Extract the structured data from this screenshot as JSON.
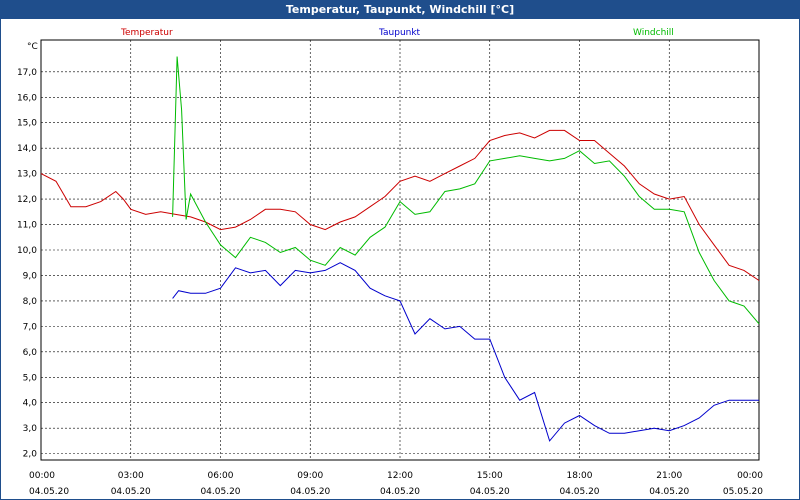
{
  "window": {
    "title": "Temperatur, Taupunkt, Windchill [°C]"
  },
  "chart_data": {
    "type": "line",
    "title": "Temperatur, Taupunkt, Windchill [°C]",
    "ylabel": "°C",
    "ylim": [
      1.75,
      18.25
    ],
    "xlim_hours": [
      0,
      24
    ],
    "grid": true,
    "legend": "top",
    "y_ticks": [
      "2,0",
      "3,0",
      "4,0",
      "5,0",
      "6,0",
      "7,0",
      "8,0",
      "9,0",
      "10,0",
      "11,0",
      "12,0",
      "13,0",
      "14,0",
      "15,0",
      "16,0",
      "17,0"
    ],
    "x_ticks": [
      {
        "time": "00:00",
        "date": "04.05.20"
      },
      {
        "time": "03:00",
        "date": "04.05.20"
      },
      {
        "time": "06:00",
        "date": "04.05.20"
      },
      {
        "time": "09:00",
        "date": "04.05.20"
      },
      {
        "time": "12:00",
        "date": "04.05.20"
      },
      {
        "time": "15:00",
        "date": "04.05.20"
      },
      {
        "time": "18:00",
        "date": "04.05.20"
      },
      {
        "time": "21:00",
        "date": "04.05.20"
      },
      {
        "time": "00:00",
        "date": "05.05.20"
      }
    ],
    "series": [
      {
        "name": "Temperatur",
        "color": "#cc0000",
        "x": [
          0,
          0.5,
          1,
          1.5,
          2,
          2.5,
          2.75,
          3,
          3.5,
          4,
          4.5,
          5,
          5.5,
          6,
          6.5,
          7,
          7.5,
          8,
          8.5,
          9,
          9.5,
          10,
          10.5,
          11,
          11.5,
          12,
          12.5,
          13,
          13.5,
          14,
          14.5,
          15,
          15.5,
          16,
          16.5,
          17,
          17.5,
          18,
          18.5,
          19,
          19.5,
          20,
          20.5,
          21,
          21.5,
          22,
          22.5,
          23,
          23.5,
          24
        ],
        "values": [
          13.0,
          12.7,
          11.7,
          11.7,
          11.9,
          12.3,
          12.0,
          11.6,
          11.4,
          11.5,
          11.4,
          11.3,
          11.1,
          10.8,
          10.9,
          11.2,
          11.6,
          11.6,
          11.5,
          11.0,
          10.8,
          11.1,
          11.3,
          11.7,
          12.1,
          12.7,
          12.9,
          12.7,
          13.0,
          13.3,
          13.6,
          14.3,
          14.5,
          14.6,
          14.4,
          14.7,
          14.7,
          14.3,
          14.3,
          13.8,
          13.3,
          12.6,
          12.2,
          12.0,
          12.1,
          11.0,
          10.2,
          9.4,
          9.2,
          8.8
        ]
      },
      {
        "name": "Taupunkt",
        "color": "#0000cc",
        "x": [
          4.4,
          4.6,
          5,
          5.5,
          6,
          6.5,
          7,
          7.5,
          8,
          8.5,
          9,
          9.5,
          10,
          10.5,
          11,
          11.5,
          12,
          12.5,
          13,
          13.5,
          14,
          14.5,
          15,
          15.5,
          16,
          16.5,
          17,
          17.5,
          18,
          18.5,
          19,
          19.5,
          20,
          20.5,
          21,
          21.5,
          22,
          22.5,
          23,
          23.5,
          24
        ],
        "values": [
          8.1,
          8.4,
          8.3,
          8.3,
          8.5,
          9.3,
          9.1,
          9.2,
          8.6,
          9.2,
          9.1,
          9.2,
          9.5,
          9.2,
          8.5,
          8.2,
          8.0,
          6.7,
          7.3,
          6.9,
          7.0,
          6.5,
          6.5,
          5.0,
          4.1,
          4.4,
          2.5,
          3.2,
          3.5,
          3.1,
          2.8,
          2.8,
          2.9,
          3.0,
          2.9,
          3.1,
          3.4,
          3.9,
          4.1,
          4.1,
          4.1
        ]
      },
      {
        "name": "Windchill",
        "color": "#00bb00",
        "x": [
          4.4,
          4.55,
          4.7,
          4.85,
          5.0,
          5.5,
          6,
          6.5,
          7,
          7.5,
          8,
          8.5,
          9,
          9.5,
          10,
          10.5,
          11,
          11.5,
          12,
          12.5,
          13,
          13.5,
          14,
          14.5,
          15,
          15.5,
          16,
          16.5,
          17,
          17.5,
          18,
          18.5,
          19,
          19.5,
          20,
          20.5,
          21,
          21.5,
          22,
          22.5,
          23,
          23.5,
          24
        ],
        "values": [
          11.3,
          17.6,
          15.5,
          11.2,
          12.2,
          11.1,
          10.2,
          9.7,
          10.5,
          10.3,
          9.9,
          10.1,
          9.6,
          9.4,
          10.1,
          9.8,
          10.5,
          10.9,
          11.9,
          11.4,
          11.5,
          12.3,
          12.4,
          12.6,
          13.5,
          13.6,
          13.7,
          13.6,
          13.5,
          13.6,
          13.9,
          13.4,
          13.5,
          12.9,
          12.1,
          11.6,
          11.6,
          11.5,
          9.9,
          8.8,
          8.0,
          7.8,
          7.1
        ]
      }
    ]
  }
}
